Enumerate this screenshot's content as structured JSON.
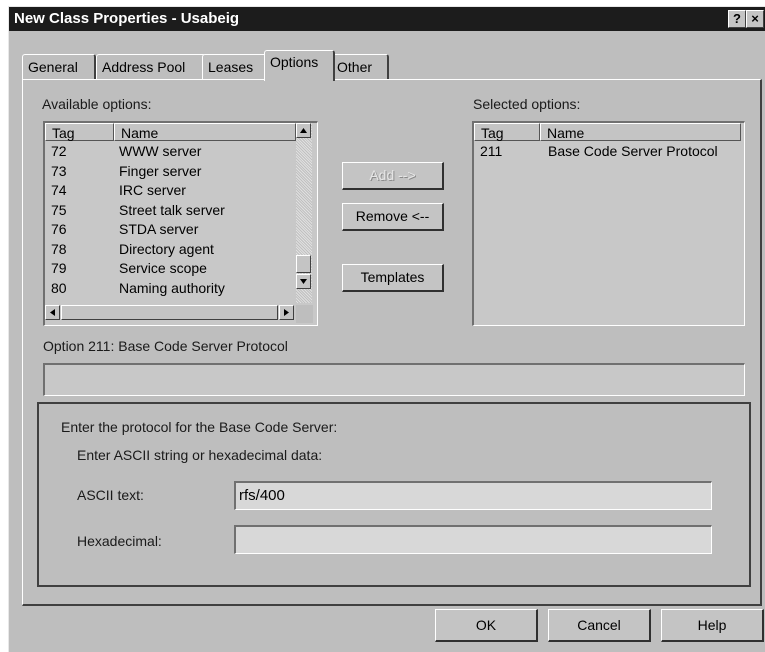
{
  "window": {
    "title": "New Class Properties - Usabeig",
    "help_glyph": "?",
    "close_glyph": "×"
  },
  "tabs": [
    {
      "label": "General"
    },
    {
      "label": "Address Pool"
    },
    {
      "label": "Leases"
    },
    {
      "label": "Options",
      "active": true
    },
    {
      "label": "Other"
    }
  ],
  "available": {
    "label": "Available options:",
    "columns": [
      "Tag",
      "Name"
    ],
    "rows": [
      {
        "tag": "72",
        "name": "WWW server"
      },
      {
        "tag": "73",
        "name": "Finger server"
      },
      {
        "tag": "74",
        "name": "IRC server"
      },
      {
        "tag": "75",
        "name": "Street talk server"
      },
      {
        "tag": "76",
        "name": "STDA server"
      },
      {
        "tag": "78",
        "name": "Directory agent"
      },
      {
        "tag": "79",
        "name": "Service scope"
      },
      {
        "tag": "80",
        "name": "Naming authority"
      }
    ]
  },
  "selected": {
    "label": "Selected options:",
    "columns": [
      "Tag",
      "Name"
    ],
    "rows": [
      {
        "tag": "211",
        "name": "Base Code Server Protocol"
      }
    ]
  },
  "buttons": {
    "add": "Add -->",
    "remove": "Remove <--",
    "templates": "Templates"
  },
  "option_label": "Option 211:  Base Code Server Protocol",
  "form": {
    "prompt": "Enter the protocol for the Base Code Server:",
    "subprompt": "Enter ASCII string or hexadecimal data:",
    "ascii_label": "ASCII text:",
    "ascii_value": "rfs/400",
    "hex_label": "Hexadecimal:",
    "hex_value": ""
  },
  "footer": {
    "ok": "OK",
    "cancel": "Cancel",
    "help": "Help"
  },
  "icons": {
    "scroll_up": "triangle-up-icon",
    "scroll_down": "triangle-down-icon",
    "scroll_left": "triangle-left-icon",
    "scroll_right": "triangle-right-icon"
  },
  "colors": {
    "titlebar": "#1c1c1c",
    "face": "#bebebe"
  }
}
